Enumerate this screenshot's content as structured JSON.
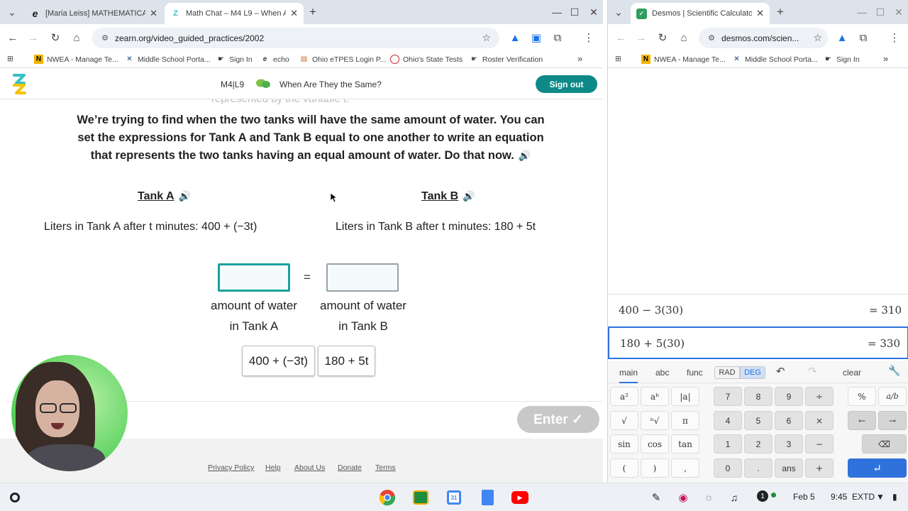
{
  "left_window": {
    "tabs": [
      {
        "title": "[Maria Leiss] MATHEMATICAL",
        "favicon": "edge-e-icon"
      },
      {
        "title": "Math Chat – M4 L9 – When Are",
        "favicon": "zearn-icon"
      }
    ],
    "new_tab": "+",
    "url": "zearn.org/video_guided_practices/2002",
    "bookmarks": [
      "NWEA - Manage Te...",
      "Middle School Porta...",
      "Sign In",
      "echo",
      "Ohio eTPES Login P...",
      "Ohio's State Tests",
      "Roster Verification"
    ],
    "bookmarks_more": "»"
  },
  "zearn": {
    "lesson_code": "M4|L9",
    "lesson_title": "When Are They the Same?",
    "sign_out": "Sign out",
    "cutoff_text": "represented by the variable t.",
    "instruction": "We’re trying to find when the two tanks will have the same amount of water. You can set the expressions for Tank A and Tank B equal to one another to write an equation that represents the two tanks having an equal amount of water. Do that now.",
    "tank_a": {
      "label": "Tank A",
      "liters": "Liters in Tank A after t minutes: 400 + (−3t)"
    },
    "tank_b": {
      "label": "Tank B",
      "liters": "Liters in Tank B after t minutes: 180 + 5t"
    },
    "equals": "=",
    "answer_a_caption": [
      "amount of water",
      "in Tank A"
    ],
    "answer_b_caption": [
      "amount of water",
      "in Tank B"
    ],
    "tiles": [
      "400 + (−3t)",
      "180 + 5t"
    ],
    "enter": "Enter ✓",
    "footer_links": [
      "Privacy Policy",
      "Help",
      "About Us",
      "Donate",
      "Terms"
    ],
    "brand_color": "#0d8a87"
  },
  "right_window": {
    "tab_title": "Desmos | Scientific Calculator",
    "url": "desmos.com/scien...",
    "bookmarks": [
      "NWEA - Manage Te...",
      "Middle School Porta...",
      "Sign In"
    ],
    "bookmarks_more": "»"
  },
  "desmos": {
    "expressions": [
      {
        "input": "400 − 3(30)",
        "result": "= 310"
      },
      {
        "input": "180 + 5(30)",
        "result": "= 330"
      }
    ],
    "tabs": [
      "main",
      "abc",
      "func"
    ],
    "angle_modes": [
      "RAD",
      "DEG"
    ],
    "clear": "clear",
    "keys_func": [
      "a²",
      "aᵇ",
      "|a|",
      "√",
      "ⁿ√",
      "π",
      "sin",
      "cos",
      "tan",
      "(",
      ")",
      ","
    ],
    "keys_num": [
      "7",
      "8",
      "9",
      "÷",
      "4",
      "5",
      "6",
      "×",
      "1",
      "2",
      "3",
      "−",
      "0",
      ".",
      "ans",
      "+"
    ],
    "keys_right": [
      "%",
      "a/b",
      "←",
      "→"
    ],
    "accent": "#2f72dc"
  },
  "taskbar": {
    "date": "Feb 5",
    "time": "9:45",
    "extd": "EXTD",
    "notif_count": "1"
  }
}
